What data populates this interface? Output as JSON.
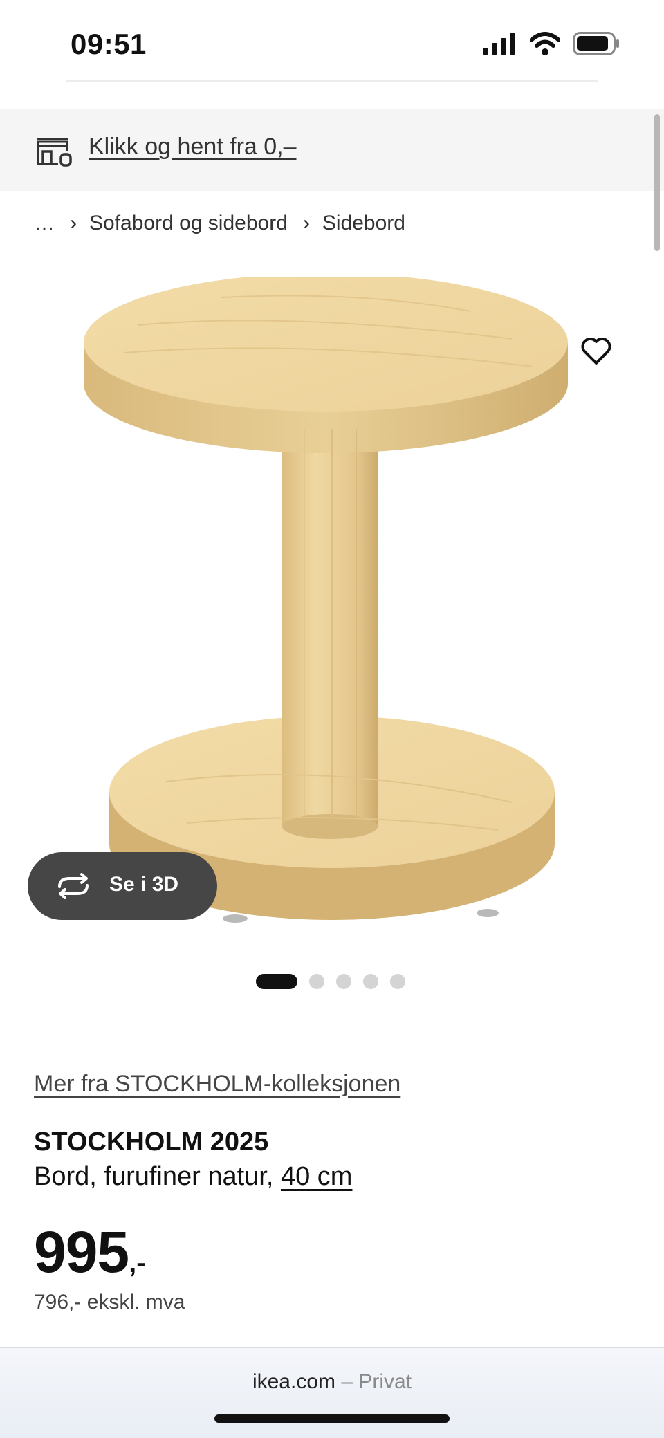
{
  "status_bar": {
    "time": "09:51"
  },
  "promo": {
    "text": "Klikk og hent fra 0,–"
  },
  "breadcrumb": {
    "ellipsis": "…",
    "items": [
      "Sofabord og sidebord",
      "Sidebord"
    ],
    "separator": "›"
  },
  "gallery": {
    "view_3d_label": "Se i 3D",
    "total_images": 5,
    "active_index": 0
  },
  "product": {
    "collection_link": "Mer fra STOCKHOLM-kolleksjonen",
    "name": "STOCKHOLM 2025",
    "description": "Bord, furufiner natur, ",
    "size": "40 cm",
    "price_main": "995",
    "price_suffix": ",-",
    "price_ex_vat": "796,- ekskl. mva"
  },
  "browser": {
    "domain": "ikea.com",
    "mode": " – Privat"
  },
  "icons": [
    "signal-icon",
    "wifi-icon",
    "battery-icon",
    "store-pickup-icon",
    "heart-icon",
    "rotate-3d-icon"
  ]
}
